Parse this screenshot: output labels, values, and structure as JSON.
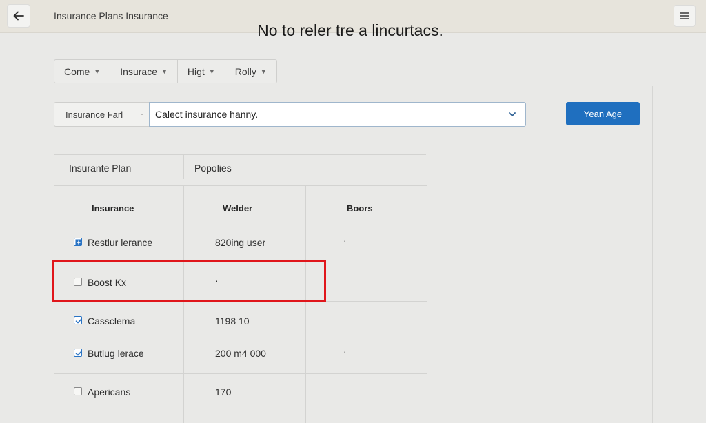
{
  "topbar": {
    "title": "Insurance Plans Insurance",
    "back_icon": "arrow-left-icon",
    "menu_icon": "hamburger-icon"
  },
  "headline": "No to reler tre a lincurtacs.",
  "filters": [
    {
      "label": "Come"
    },
    {
      "label": "Insurace"
    },
    {
      "label": "Higt"
    },
    {
      "label": "Rolly"
    }
  ],
  "search": {
    "field_label": "Insurance Farl",
    "field_dash": "-",
    "select_value": "Calect insurance hanny.",
    "button_label": "Yean Age"
  },
  "table": {
    "group_headers": [
      "Insurante Plan",
      "Popolies"
    ],
    "columns": [
      "Insurance",
      "Welder",
      "Boors"
    ],
    "rows": [
      {
        "name": "Restlur lerance",
        "value": "820ing user",
        "extra": "·",
        "state": "plus"
      },
      {
        "name": "Boost Kx",
        "value": "·",
        "extra": "",
        "state": "unchecked"
      },
      {
        "name": "Cassclema",
        "value": "1198 10",
        "extra": "",
        "state": "checked"
      },
      {
        "name": "Butlug lerace",
        "value": "200 m4 000",
        "extra": "·",
        "state": "checked"
      },
      {
        "name": "Apericans",
        "value": "170",
        "extra": "",
        "state": "unchecked"
      }
    ]
  },
  "colors": {
    "primary": "#1f6fbf",
    "highlight": "#e0161b",
    "background": "#e9e9e7"
  }
}
